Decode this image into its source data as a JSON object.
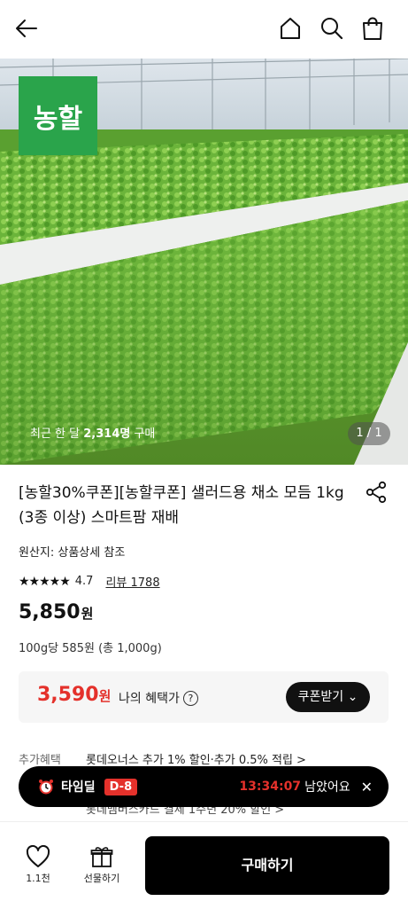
{
  "header": {
    "back_icon": "arrow-left-icon",
    "home_icon": "home-icon",
    "search_icon": "search-icon",
    "cart_icon": "shopping-bag-icon"
  },
  "hero": {
    "brand_logo": "농할",
    "buyers_prefix": "최근 한 달 ",
    "buyers_count": "2,314명",
    "buyers_suffix": " 구매",
    "pager": "1 / 1"
  },
  "product": {
    "title": "[농할30%쿠폰][농할쿠폰] 샐러드용 채소 모듬 1kg (3종 이상) 스마트팜 재배",
    "origin": "원산지: 상품상세 참조",
    "rating": "4.7",
    "rating_stars": 4.7,
    "reviews": "리뷰 1788",
    "price": "5,850",
    "price_unit": "원",
    "unit_price": "100g당 585원 (총 1,000g)"
  },
  "benefit": {
    "price": "3,590",
    "price_unit": "원",
    "label": "나의 혜택가",
    "help": "?",
    "coupon_button": "쿠폰받기",
    "accent": "#e4312b"
  },
  "extra": {
    "label": "추가혜택",
    "line1": "롯데오너스 추가 1% 할인·추가 0.5% 적립 >",
    "line2": "롯데멤버스카드 결제 1주년 20% 할인 >"
  },
  "timedeal": {
    "label": "타임딜",
    "dday": "D-8",
    "timer": "13:34:07",
    "remain": "남았어요",
    "close": "✕"
  },
  "bottom": {
    "like_count": "1.1천",
    "gift_label": "선물하기",
    "buy_label": "구매하기"
  }
}
